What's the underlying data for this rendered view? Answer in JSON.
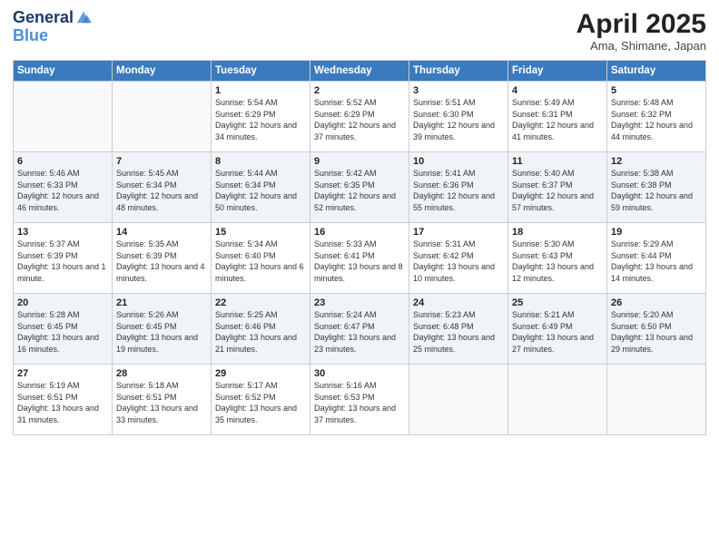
{
  "header": {
    "logo_line1": "General",
    "logo_line2": "Blue",
    "month": "April 2025",
    "location": "Ama, Shimane, Japan"
  },
  "days_of_week": [
    "Sunday",
    "Monday",
    "Tuesday",
    "Wednesday",
    "Thursday",
    "Friday",
    "Saturday"
  ],
  "weeks": [
    [
      {
        "day": "",
        "info": ""
      },
      {
        "day": "",
        "info": ""
      },
      {
        "day": "1",
        "info": "Sunrise: 5:54 AM\nSunset: 6:29 PM\nDaylight: 12 hours and 34 minutes."
      },
      {
        "day": "2",
        "info": "Sunrise: 5:52 AM\nSunset: 6:29 PM\nDaylight: 12 hours and 37 minutes."
      },
      {
        "day": "3",
        "info": "Sunrise: 5:51 AM\nSunset: 6:30 PM\nDaylight: 12 hours and 39 minutes."
      },
      {
        "day": "4",
        "info": "Sunrise: 5:49 AM\nSunset: 6:31 PM\nDaylight: 12 hours and 41 minutes."
      },
      {
        "day": "5",
        "info": "Sunrise: 5:48 AM\nSunset: 6:32 PM\nDaylight: 12 hours and 44 minutes."
      }
    ],
    [
      {
        "day": "6",
        "info": "Sunrise: 5:46 AM\nSunset: 6:33 PM\nDaylight: 12 hours and 46 minutes."
      },
      {
        "day": "7",
        "info": "Sunrise: 5:45 AM\nSunset: 6:34 PM\nDaylight: 12 hours and 48 minutes."
      },
      {
        "day": "8",
        "info": "Sunrise: 5:44 AM\nSunset: 6:34 PM\nDaylight: 12 hours and 50 minutes."
      },
      {
        "day": "9",
        "info": "Sunrise: 5:42 AM\nSunset: 6:35 PM\nDaylight: 12 hours and 52 minutes."
      },
      {
        "day": "10",
        "info": "Sunrise: 5:41 AM\nSunset: 6:36 PM\nDaylight: 12 hours and 55 minutes."
      },
      {
        "day": "11",
        "info": "Sunrise: 5:40 AM\nSunset: 6:37 PM\nDaylight: 12 hours and 57 minutes."
      },
      {
        "day": "12",
        "info": "Sunrise: 5:38 AM\nSunset: 6:38 PM\nDaylight: 12 hours and 59 minutes."
      }
    ],
    [
      {
        "day": "13",
        "info": "Sunrise: 5:37 AM\nSunset: 6:39 PM\nDaylight: 13 hours and 1 minute."
      },
      {
        "day": "14",
        "info": "Sunrise: 5:35 AM\nSunset: 6:39 PM\nDaylight: 13 hours and 4 minutes."
      },
      {
        "day": "15",
        "info": "Sunrise: 5:34 AM\nSunset: 6:40 PM\nDaylight: 13 hours and 6 minutes."
      },
      {
        "day": "16",
        "info": "Sunrise: 5:33 AM\nSunset: 6:41 PM\nDaylight: 13 hours and 8 minutes."
      },
      {
        "day": "17",
        "info": "Sunrise: 5:31 AM\nSunset: 6:42 PM\nDaylight: 13 hours and 10 minutes."
      },
      {
        "day": "18",
        "info": "Sunrise: 5:30 AM\nSunset: 6:43 PM\nDaylight: 13 hours and 12 minutes."
      },
      {
        "day": "19",
        "info": "Sunrise: 5:29 AM\nSunset: 6:44 PM\nDaylight: 13 hours and 14 minutes."
      }
    ],
    [
      {
        "day": "20",
        "info": "Sunrise: 5:28 AM\nSunset: 6:45 PM\nDaylight: 13 hours and 16 minutes."
      },
      {
        "day": "21",
        "info": "Sunrise: 5:26 AM\nSunset: 6:45 PM\nDaylight: 13 hours and 19 minutes."
      },
      {
        "day": "22",
        "info": "Sunrise: 5:25 AM\nSunset: 6:46 PM\nDaylight: 13 hours and 21 minutes."
      },
      {
        "day": "23",
        "info": "Sunrise: 5:24 AM\nSunset: 6:47 PM\nDaylight: 13 hours and 23 minutes."
      },
      {
        "day": "24",
        "info": "Sunrise: 5:23 AM\nSunset: 6:48 PM\nDaylight: 13 hours and 25 minutes."
      },
      {
        "day": "25",
        "info": "Sunrise: 5:21 AM\nSunset: 6:49 PM\nDaylight: 13 hours and 27 minutes."
      },
      {
        "day": "26",
        "info": "Sunrise: 5:20 AM\nSunset: 6:50 PM\nDaylight: 13 hours and 29 minutes."
      }
    ],
    [
      {
        "day": "27",
        "info": "Sunrise: 5:19 AM\nSunset: 6:51 PM\nDaylight: 13 hours and 31 minutes."
      },
      {
        "day": "28",
        "info": "Sunrise: 5:18 AM\nSunset: 6:51 PM\nDaylight: 13 hours and 33 minutes."
      },
      {
        "day": "29",
        "info": "Sunrise: 5:17 AM\nSunset: 6:52 PM\nDaylight: 13 hours and 35 minutes."
      },
      {
        "day": "30",
        "info": "Sunrise: 5:16 AM\nSunset: 6:53 PM\nDaylight: 13 hours and 37 minutes."
      },
      {
        "day": "",
        "info": ""
      },
      {
        "day": "",
        "info": ""
      },
      {
        "day": "",
        "info": ""
      }
    ]
  ]
}
